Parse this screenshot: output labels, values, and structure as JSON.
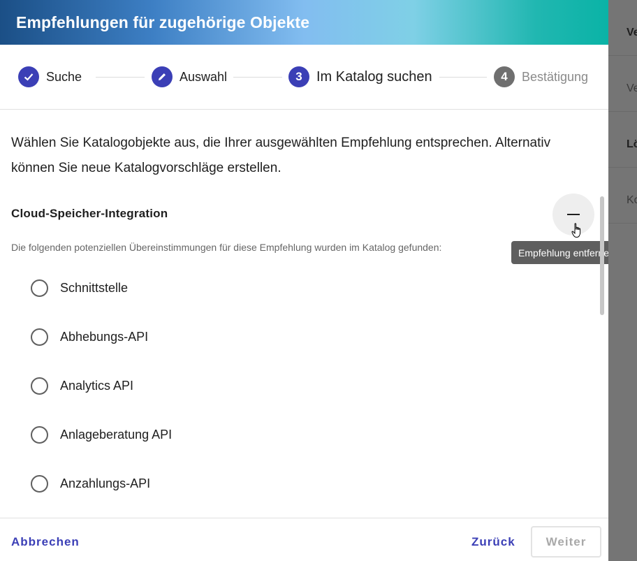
{
  "dialog": {
    "title": "Empfehlungen für zugehörige Objekte"
  },
  "stepper": {
    "steps": [
      {
        "label": "Suche",
        "state": "done",
        "icon": "check-icon"
      },
      {
        "label": "Auswahl",
        "state": "edit",
        "icon": "pencil-icon"
      },
      {
        "number": "3",
        "label": "Im Katalog suchen",
        "state": "current"
      },
      {
        "number": "4",
        "label": "Bestätigung",
        "state": "upcoming"
      }
    ]
  },
  "content": {
    "intro": "Wählen Sie Katalogobjekte aus, die Ihrer ausgewählten Empfehlung entsprechen. Alternativ können Sie neue Katalogvorschläge erstellen.",
    "section_title": "Cloud-Speicher-Integration",
    "hint": "Die folgenden potenziellen Übereinstimmungen für diese Empfehlung wurden im Katalog gefunden:",
    "remove_tooltip": "Empfehlung entfernen",
    "options": [
      {
        "label": "Schnittstelle",
        "selected": false
      },
      {
        "label": "Abhebungs-API",
        "selected": false
      },
      {
        "label": "Analytics API",
        "selected": false
      },
      {
        "label": "Anlageberatung API",
        "selected": false
      },
      {
        "label": "Anzahlungs-API",
        "selected": false
      }
    ]
  },
  "footer": {
    "cancel_label": "Abbrechen",
    "back_label": "Zurück",
    "next_label": "Weiter"
  },
  "background": {
    "rows": [
      "Ve",
      "Ve",
      "Lö",
      "Ko"
    ]
  },
  "colors": {
    "accent": "#3b3fb6",
    "step_inactive": "#6f6f6f",
    "tooltip_bg": "#5e5e5e"
  }
}
